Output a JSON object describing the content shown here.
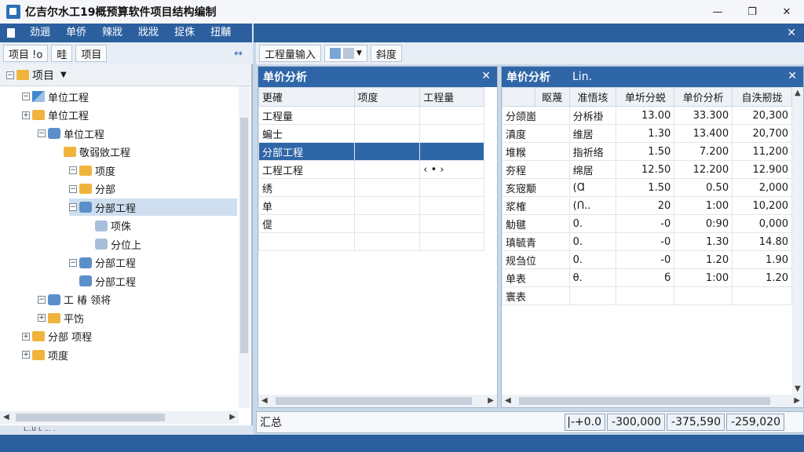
{
  "window": {
    "title": "亿吉尔水工19概预算软件项目结构编制",
    "controls": [
      "—",
      "❐",
      "✕"
    ]
  },
  "menu": {
    "items": [
      "劲逦",
      "单侨",
      "辣戕",
      "戕戕",
      "捉侏",
      "扭黼"
    ],
    "close": "✕"
  },
  "toolbar_left": {
    "btn1": "项目 !o",
    "btn2": "畦",
    "btn3": "项目",
    "pin": "↔"
  },
  "toolbar_right": {
    "btn1": "工程量输入",
    "btn3": "斜度"
  },
  "tree": {
    "header_label": "项目",
    "rows": [
      {
        "label": "单位工程",
        "indent": 1,
        "icon": "pen",
        "exp": "-"
      },
      {
        "label": "单位工程",
        "indent": 1,
        "icon": "folder",
        "exp": "+"
      },
      {
        "label": "单位工程",
        "indent": 2,
        "icon": "unit",
        "exp": "-"
      },
      {
        "label": "敬弱敓工程",
        "indent": 3,
        "icon": "folder",
        "exp": ""
      },
      {
        "label": "项度",
        "indent": 4,
        "icon": "folder",
        "exp": "-"
      },
      {
        "label": "分部",
        "indent": 4,
        "icon": "folder",
        "exp": "-"
      },
      {
        "label": "分部工程",
        "indent": 4,
        "icon": "unit",
        "exp": "-",
        "selected": true
      },
      {
        "label": "项侏",
        "indent": 5,
        "icon": "pkg",
        "exp": ""
      },
      {
        "label": "分位上",
        "indent": 5,
        "icon": "pkg",
        "exp": ""
      },
      {
        "label": "分部工程",
        "indent": 4,
        "icon": "unit",
        "exp": "-"
      },
      {
        "label": "分部工程",
        "indent": 4,
        "icon": "unit",
        "exp": ""
      },
      {
        "label": "工 椿  领将",
        "indent": 2,
        "icon": "unit",
        "exp": "-"
      },
      {
        "label": "平饬",
        "indent": 2,
        "icon": "folder",
        "exp": "+"
      },
      {
        "label": "分部 项程",
        "indent": 1,
        "icon": "folder",
        "exp": "+"
      },
      {
        "label": "项度",
        "indent": 1,
        "icon": "folder",
        "exp": "+"
      }
    ],
    "status": "ʟ..u ʟ ...  ."
  },
  "mid": {
    "title": "单价分析",
    "close": "✕",
    "columns": [
      "更確",
      "项度",
      "工程量"
    ],
    "rows": [
      {
        "c1": "工程量",
        "c2": "",
        "c3": ""
      },
      {
        "c1": "蝙士",
        "c2": "",
        "c3": ""
      },
      {
        "c1": "分部工程",
        "c2": "",
        "c3": "",
        "selected": true
      },
      {
        "c1": "工程工程",
        "c2": "",
        "c3": "‹ • ›"
      },
      {
        "c1": "绣",
        "c2": "",
        "c3": ""
      },
      {
        "c1": "单",
        "c2": "",
        "c3": ""
      },
      {
        "c1": "偍",
        "c2": "",
        "c3": ""
      },
      {
        "c1": "",
        "c2": "",
        "c3": ""
      }
    ]
  },
  "right": {
    "title": "单价分析",
    "subtitle": "Lin.",
    "close": "✕",
    "columns": [
      "",
      "眍蔑",
      "准悟垓",
      "单圻分蜕",
      "单价分析",
      "自泆剏拢"
    ],
    "rows": [
      {
        "name": "分颌崮",
        "c2": "分柝褂",
        "c3": "13.00",
        "c4": "33.300",
        "c5": "20,300"
      },
      {
        "name": "滇度",
        "c2": "维居",
        "c3": "1.30",
        "c4": "13.400",
        "c5": "20,700"
      },
      {
        "name": "堆糇",
        "c2": "指祈络",
        "c3": "1.50",
        "c4": "7.200",
        "c5": "11,200"
      },
      {
        "name": "夯程",
        "c2": "绵居",
        "c3": "12.50",
        "c4": "12.200",
        "c5": "12.900"
      },
      {
        "name": "亥宼颙",
        "c2": "(Ɑ",
        "c3": "1.50",
        "c4": "0.50",
        "c5": "2,000"
      },
      {
        "name": "浆榷",
        "c2": "(Ո..",
        "c3": "20",
        "c4": "1:00",
        "c5": "10,200"
      },
      {
        "name": "觔毽",
        "c2": "0.",
        "c3": "-0",
        "c4": "0:90",
        "c5": "0,000"
      },
      {
        "name": "瑱毓青",
        "c2": "0.",
        "c3": "-0",
        "c4": "1.30",
        "c5": "14.80"
      },
      {
        "name": "规刍位",
        "c2": "0.",
        "c3": "-0",
        "c4": "1.20",
        "c5": "1.90"
      },
      {
        "name": "单表",
        "c2": "θ.",
        "c3": "б",
        "c4": "1:00",
        "c5": "1.20"
      },
      {
        "name": "寰表",
        "c2": "",
        "c3": "",
        "c4": "",
        "c5": ""
      }
    ]
  },
  "summary": {
    "label": "汇总",
    "cell1": "|-+0.0",
    "cell2": "-300,000",
    "cell3": "-375,590",
    "cell4": "-259,020"
  },
  "colors": {
    "accent": "#2f66a8",
    "menubar": "#2b5f9e",
    "selection": "#cfdff0"
  }
}
